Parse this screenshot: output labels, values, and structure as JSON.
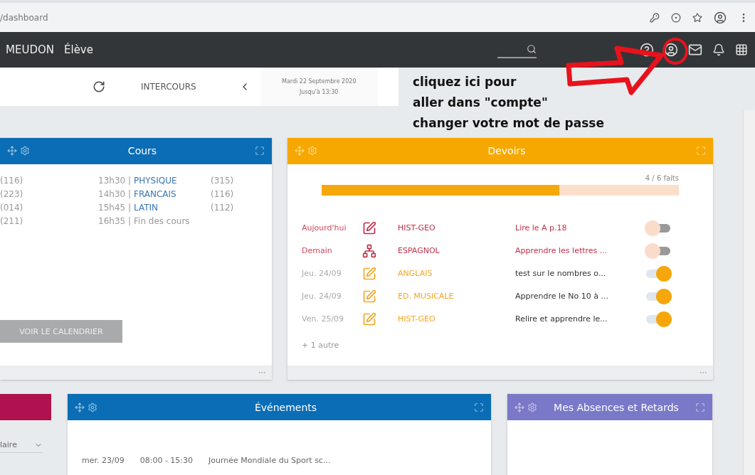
{
  "browser": {
    "url": "/dashboard"
  },
  "nav": {
    "school": "MEUDON",
    "role": "Élève"
  },
  "toolbar": {
    "mode": "INTERCOURS",
    "date": "Mardi 22 Septembre 2020",
    "until": "Jusqu'à 13:30"
  },
  "annotation": {
    "lines": [
      "cliquez ici pour",
      "aller dans \"compte\"",
      "changer votre mot de passe"
    ]
  },
  "cours": {
    "title": "Cours",
    "rows": [
      {
        "left": "(116)",
        "time": "13h30 |",
        "label": "PHYSIQUE",
        "room": "(315)",
        "kind": "lesson"
      },
      {
        "left": "(223)",
        "time": "14h30 |",
        "label": "FRANCAIS",
        "room": "(116)",
        "kind": "lesson"
      },
      {
        "left": "(014)",
        "time": "15h45 |",
        "label": "LATIN",
        "room": "(112)",
        "kind": "lesson"
      },
      {
        "left": "(211)",
        "time": "16h35 |",
        "label": "Fin des cours",
        "kind": "end"
      }
    ],
    "button": "VOIR LE CALENDRIER"
  },
  "devoirs": {
    "title": "Devoirs",
    "progress_label": "4 / 6 faits",
    "level": 0.665,
    "rows": [
      {
        "date": "Aujourd'hui",
        "kind": "edit",
        "subject": "HIST-GEO",
        "text": "Lire le A p.18",
        "urgent": true,
        "done": false
      },
      {
        "date": "Demain",
        "kind": "network",
        "subject": "ESPAGNOL",
        "text": "Apprendre les lettres ...",
        "urgent": true,
        "done": false
      },
      {
        "date": "Jeu. 24/09",
        "kind": "edit",
        "subject": "ANGLAIS",
        "text": "test sur le nombres o...",
        "urgent": false,
        "done": true
      },
      {
        "date": "Jeu. 24/09",
        "kind": "edit",
        "subject": "ED. MUSICALE",
        "text": "Apprendre le No 10 à ...",
        "urgent": false,
        "done": true
      },
      {
        "date": "Ven. 25/09",
        "kind": "edit",
        "subject": "HIST-GEO",
        "text": "Relire et apprendre le...",
        "urgent": false,
        "done": true
      }
    ],
    "more": "+ 1 autre"
  },
  "bottom": {
    "select": {
      "value": "laire"
    },
    "events": {
      "title": "Événements",
      "rows": [
        {
          "date": "mer. 23/09",
          "time": "08:00 - 15:30",
          "label": "Journée Mondiale du Sport sc..."
        }
      ]
    },
    "absences": {
      "title": "Mes Absences et Retards"
    }
  }
}
